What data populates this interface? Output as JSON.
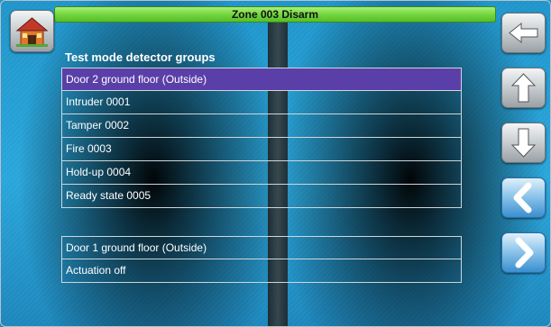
{
  "title_bar": {
    "text": "Zone 003  Disarm"
  },
  "section": {
    "heading": "Test mode detector groups"
  },
  "list1": {
    "items": [
      {
        "label": "Door 2 ground floor (Outside)",
        "selected": true
      },
      {
        "label": "Intruder 0001"
      },
      {
        "label": "Tamper 0002"
      },
      {
        "label": "Fire 0003"
      },
      {
        "label": "Hold-up 0004"
      },
      {
        "label": "Ready state 0005"
      }
    ]
  },
  "list2": {
    "items": [
      {
        "label": "Door 1 ground floor (Outside)"
      },
      {
        "label": "Actuation off"
      }
    ]
  },
  "buttons": {
    "home": {
      "icon": "home-icon"
    },
    "back": {
      "icon": "arrow-left-icon"
    },
    "up": {
      "icon": "arrow-up-icon"
    },
    "down": {
      "icon": "arrow-down-icon"
    },
    "prev": {
      "icon": "chevron-left-icon"
    },
    "next": {
      "icon": "chevron-right-icon"
    }
  },
  "colors": {
    "background": "#2aa6db",
    "title_bar": "#74d63f",
    "selected_row": "#5b3fa8"
  }
}
